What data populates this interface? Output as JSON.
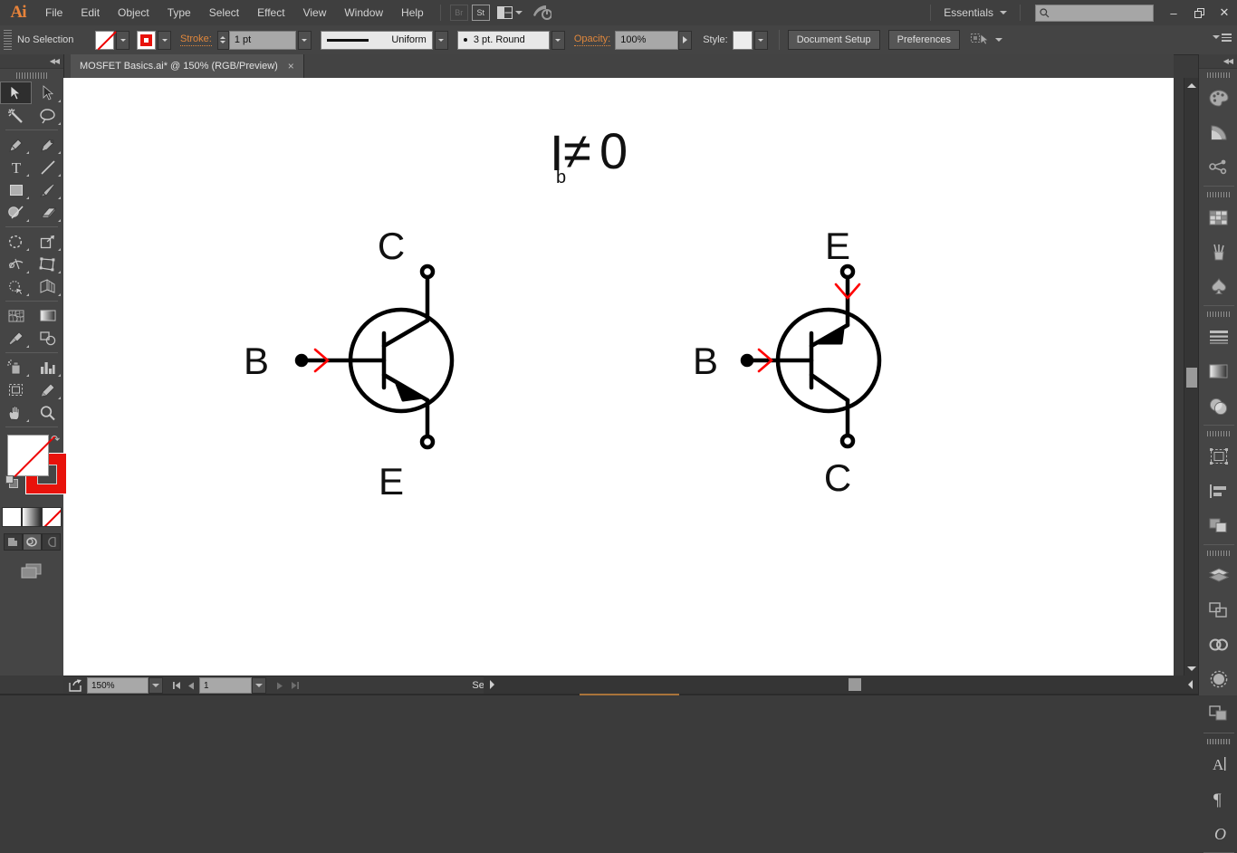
{
  "app": {
    "name": "Adobe Illustrator",
    "logo": "Ai"
  },
  "menubar": {
    "items": [
      "File",
      "Edit",
      "Object",
      "Type",
      "Select",
      "Effect",
      "View",
      "Window",
      "Help"
    ],
    "bridge_label": "Br",
    "stock_label": "St",
    "arrange_icon": "arrange-documents-icon",
    "home_icon": "home-icon",
    "workspace": "Essentials",
    "search_placeholder": "",
    "search_value": "",
    "minimize": "–",
    "maximize": "❐",
    "close": "✕"
  },
  "controlbar": {
    "selection_state": "No Selection",
    "fill_swatch": "none-fill-swatch",
    "stroke_swatch": "red-stroke-swatch",
    "stroke_label": "Stroke:",
    "stroke_weight": "1 pt",
    "profile_label": "Uniform",
    "brush_label": "3 pt. Round",
    "opacity_label": "Opacity:",
    "opacity_value": "100%",
    "style_label": "Style:",
    "document_setup": "Document Setup",
    "preferences": "Preferences",
    "align_icon": "align-to-selection-icon",
    "panel_menu_icon": "panel-menu-icon"
  },
  "tabs": {
    "active": "MOSFET Basics.ai* @ 150% (RGB/Preview)",
    "close_glyph": "×"
  },
  "toolbar": {
    "collapse_glyph": "◀◀",
    "tools": [
      {
        "name": "selection-tool",
        "active": true
      },
      {
        "name": "direct-selection-tool",
        "active": false
      },
      {
        "name": "magic-wand-tool",
        "active": false
      },
      {
        "name": "lasso-tool",
        "active": false
      },
      {
        "name": "pen-tool",
        "active": false
      },
      {
        "name": "curvature-tool",
        "active": false
      },
      {
        "name": "type-tool",
        "active": false
      },
      {
        "name": "line-segment-tool",
        "active": false
      },
      {
        "name": "rectangle-tool",
        "active": false
      },
      {
        "name": "paintbrush-tool",
        "active": false
      },
      {
        "name": "shaper-tool",
        "active": false
      },
      {
        "name": "eraser-tool",
        "active": false
      },
      {
        "name": "rotate-tool",
        "active": false
      },
      {
        "name": "scale-tool",
        "active": false
      },
      {
        "name": "width-tool",
        "active": false
      },
      {
        "name": "free-transform-tool",
        "active": false
      },
      {
        "name": "shape-builder-tool",
        "active": false
      },
      {
        "name": "perspective-grid-tool",
        "active": false
      },
      {
        "name": "mesh-tool",
        "active": false
      },
      {
        "name": "gradient-tool",
        "active": false
      },
      {
        "name": "eyedropper-tool",
        "active": false
      },
      {
        "name": "blend-tool",
        "active": false
      },
      {
        "name": "symbol-sprayer-tool",
        "active": false
      },
      {
        "name": "column-graph-tool",
        "active": false
      },
      {
        "name": "artboard-tool",
        "active": false
      },
      {
        "name": "slice-tool",
        "active": false
      },
      {
        "name": "hand-tool",
        "active": false
      },
      {
        "name": "zoom-tool",
        "active": false
      }
    ],
    "fill_state": "None",
    "stroke_color": "#e8120b",
    "color_modes": [
      "color-mode-color",
      "color-mode-gradient",
      "color-mode-none"
    ],
    "screen_modes": [
      "normal-screen-mode",
      "full-screen-with-menu-bar",
      "full-screen-mode"
    ],
    "edit_toolbar_icon": "edit-toolbar-icon"
  },
  "dock": {
    "collapse_glyph": "◀◀",
    "groups": [
      [
        "color-panel-icon",
        "color-guide-panel-icon",
        "color-themes-panel-icon"
      ],
      [
        "swatches-panel-icon",
        "brushes-panel-icon",
        "symbols-panel-icon"
      ],
      [
        "stroke-panel-icon",
        "gradient-panel-icon",
        "transparency-panel-icon"
      ],
      [
        "artboards-panel-icon",
        "align-panel-icon",
        "pathfinder-panel-icon"
      ],
      [
        "layers-panel-icon",
        "transform-panel-icon",
        "links-panel-icon",
        "appearance-panel-icon",
        "graphic-styles-panel-icon"
      ],
      [
        "character-panel-icon",
        "paragraph-panel-icon",
        "glyphs-panel-icon"
      ]
    ]
  },
  "statusbar": {
    "export_icon": "export-for-screens-icon",
    "zoom_level": "150%",
    "artboard_number": "1",
    "status_text": "Selection",
    "first_glyph": "⏮",
    "prev_glyph": "◀",
    "next_glyph": "▶",
    "last_glyph": "⏭"
  },
  "artwork": {
    "formula": {
      "main": "I",
      "subscript": "b",
      "relation": "≠",
      "value": "0"
    },
    "transistors": [
      {
        "type": "NPN",
        "name": "npn-transistor-symbol",
        "top_label": "C",
        "bottom_label": "E",
        "base_label": "B",
        "arrow_direction": "outward-to-emitter",
        "current_markers": [
          "base-current-arrow"
        ],
        "stroke_color": "#000000",
        "marker_color": "#ff0000"
      },
      {
        "type": "PNP",
        "name": "pnp-transistor-symbol",
        "top_label": "E",
        "bottom_label": "C",
        "base_label": "B",
        "arrow_direction": "inward-from-emitter",
        "current_markers": [
          "base-current-arrow",
          "emitter-current-arrow"
        ],
        "stroke_color": "#000000",
        "marker_color": "#ff0000"
      }
    ]
  },
  "colors": {
    "chrome_bg": "#3b3b3b",
    "panel_bg": "#454545",
    "canvas_bg": "#ffffff",
    "accent_orange": "#e0873c",
    "stroke_red": "#e8120b"
  }
}
